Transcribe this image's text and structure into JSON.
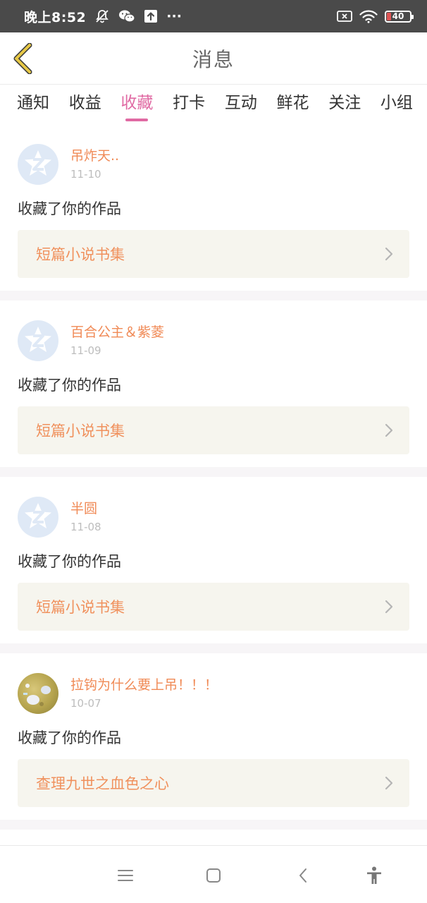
{
  "status_bar": {
    "time": "晚上8:52",
    "more": "···",
    "battery": "40"
  },
  "header": {
    "title": "消息"
  },
  "tabs": [
    {
      "label": "通知",
      "active": false
    },
    {
      "label": "收益",
      "active": false
    },
    {
      "label": "收藏",
      "active": true
    },
    {
      "label": "打卡",
      "active": false
    },
    {
      "label": "互动",
      "active": false
    },
    {
      "label": "鲜花",
      "active": false
    },
    {
      "label": "关注",
      "active": false
    },
    {
      "label": "小组",
      "active": false
    }
  ],
  "messages": [
    {
      "user": "吊炸天..",
      "date": "11-10",
      "action": "收藏了你的作品",
      "work": "短篇小说书集",
      "avatar": "default-avatar-icon"
    },
    {
      "user": "百合公主＆紫菱",
      "date": "11-09",
      "action": "收藏了你的作品",
      "work": "短篇小说书集",
      "avatar": "default-avatar-icon"
    },
    {
      "user": "半圆",
      "date": "11-08",
      "action": "收藏了你的作品",
      "work": "短篇小说书集",
      "avatar": "default-avatar-icon"
    },
    {
      "user": "拉钩为什么要上吊！！！",
      "date": "10-07",
      "action": "收藏了你的作品",
      "work": "查理九世之血色之心",
      "avatar": "photo-avatar"
    }
  ],
  "colors": {
    "accent": "#e06aa3",
    "username": "#f08a56",
    "work_title": "#f0915d",
    "work_bg": "#f6f5ee",
    "status_bar_bg": "#4a4a4a",
    "back_arrow": "#e7c846"
  },
  "system_nav": [
    "menu-icon",
    "home-icon",
    "back-icon",
    "accessibility-icon"
  ]
}
